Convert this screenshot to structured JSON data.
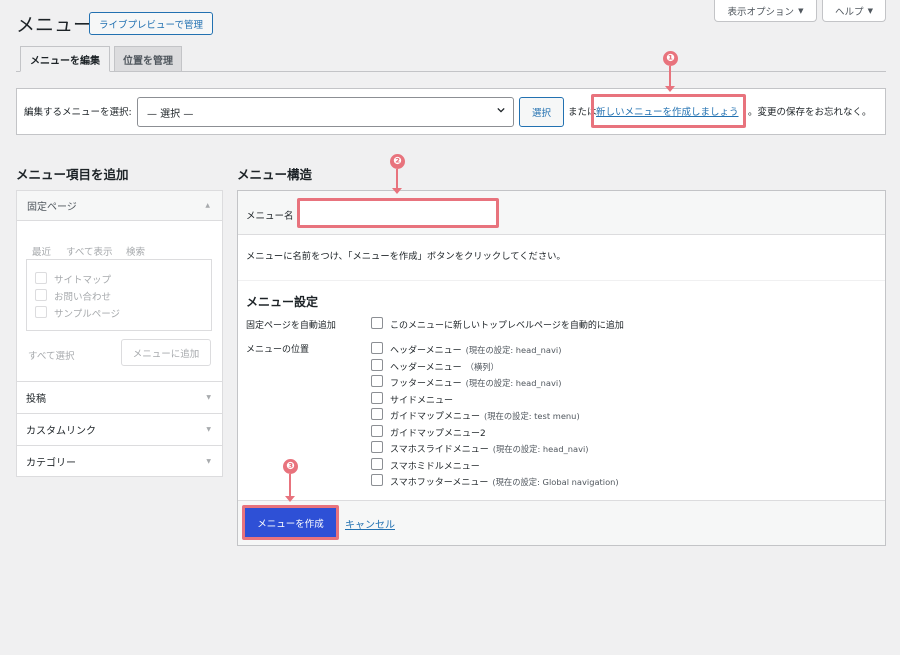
{
  "header": {
    "title": "メニュー",
    "live_preview_label": "ライブプレビューで管理",
    "screen_options_label": "表示オプション",
    "help_label": "ヘルプ"
  },
  "tabs": [
    {
      "label": "メニューを編集",
      "active": true
    },
    {
      "label": "位置を管理",
      "active": false
    }
  ],
  "select_menu": {
    "label": "編集するメニューを選択:",
    "selected": "— 選択 —",
    "select_button": "選択",
    "or_text": "または",
    "new_menu_link": "新しいメニューを作成しましょう",
    "save_reminder": "。変更の保存をお忘れなく。"
  },
  "add_items": {
    "heading": "メニュー項目を追加",
    "sections": [
      {
        "label": "固定ページ",
        "expanded": true
      },
      {
        "label": "投稿",
        "expanded": false
      },
      {
        "label": "カスタムリンク",
        "expanded": false
      },
      {
        "label": "カテゴリー",
        "expanded": false
      }
    ],
    "subtabs": [
      "最近",
      "すべて表示",
      "検索"
    ],
    "pages": [
      "サイトマップ",
      "お問い合わせ",
      "サンプルページ"
    ],
    "select_all": "すべて選択",
    "add_to_menu": "メニューに追加"
  },
  "structure": {
    "heading": "メニュー構造",
    "name_label": "メニュー名",
    "name_value": "",
    "instruction": "メニューに名前をつけ、「メニューを作成」ボタンをクリックしてください。",
    "settings_heading": "メニュー設定",
    "auto_add_label": "固定ページを自動追加",
    "auto_add_option": "このメニューに新しいトップレベルページを自動的に追加",
    "locations_label": "メニューの位置",
    "locations": [
      {
        "name": "ヘッダーメニュー",
        "note": "(現在の設定: head_navi)"
      },
      {
        "name": "ヘッダーメニュー",
        "note": "（横列）"
      },
      {
        "name": "フッターメニュー",
        "note": "(現在の設定: head_navi)"
      },
      {
        "name": "サイドメニュー",
        "note": ""
      },
      {
        "name": "ガイドマップメニュー",
        "note": "(現在の設定: test menu)"
      },
      {
        "name": "ガイドマップメニュー2",
        "note": ""
      },
      {
        "name": "スマホスライドメニュー",
        "note": "(現在の設定: head_navi)"
      },
      {
        "name": "スマホミドルメニュー",
        "note": ""
      },
      {
        "name": "スマホフッターメニュー",
        "note": "(現在の設定: Global navigation)"
      }
    ],
    "create_button": "メニューを作成",
    "cancel_link": "キャンセル"
  },
  "annotations": {
    "marker1": "❶",
    "marker2": "❷",
    "marker3": "❸",
    "color": "#e8737d"
  }
}
